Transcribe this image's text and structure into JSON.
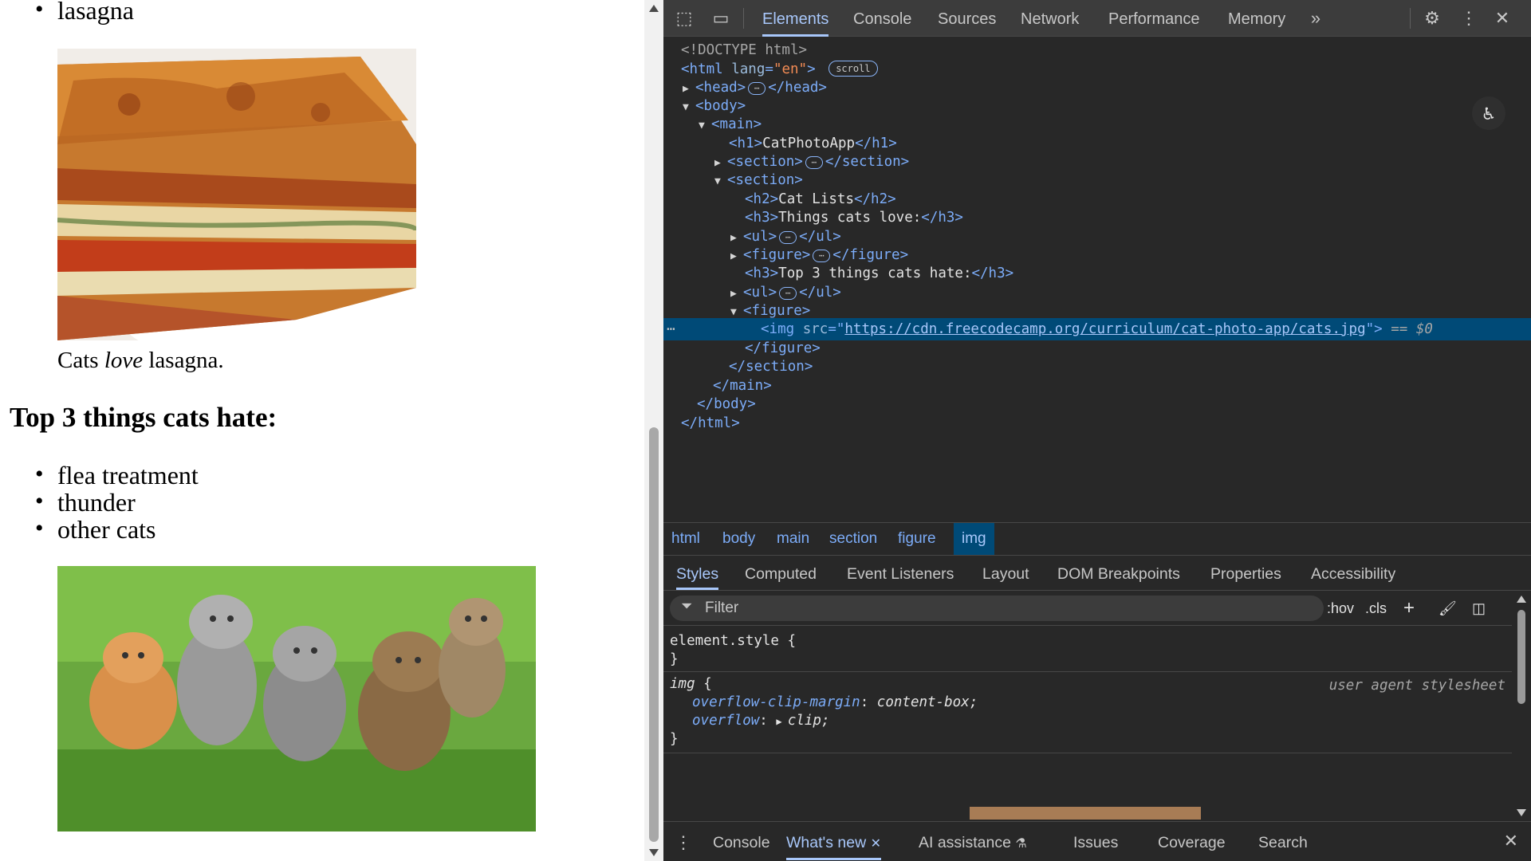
{
  "page": {
    "list_top": [
      "lasagna"
    ],
    "caption_pre": "Cats ",
    "caption_em": "love",
    "caption_post": " lasagna.",
    "hate_heading": "Top 3 things cats hate:",
    "hate_items": [
      "flea treatment",
      "thunder",
      "other cats"
    ]
  },
  "devtools": {
    "tabs": [
      "Elements",
      "Console",
      "Sources",
      "Network",
      "Performance",
      "Memory"
    ],
    "active_tab": "Elements",
    "more_tabs_icon": "chevron-double-right-icon",
    "dom": {
      "doctype": "<!DOCTYPE html>",
      "html_open": "<html",
      "lang_attr": "lang",
      "lang_val": "\"en\"",
      "scroll_pill": "scroll",
      "head_open": "<head>",
      "head_close": "</head>",
      "body_open": "<body>",
      "main_open": "<main>",
      "h1_open": "<h1>",
      "h1_text": "CatPhotoApp",
      "h1_close": "</h1>",
      "section_open": "<section>",
      "section_close": "</section>",
      "h2_open": "<h2>",
      "h2_text": "Cat Lists",
      "h2_close": "</h2>",
      "h3_open": "<h3>",
      "h3_text_love": "Things cats love:",
      "h3_close": "</h3>",
      "ul_open": "<ul>",
      "ul_close": "</ul>",
      "figure_open": "<figure>",
      "figure_close": "</figure>",
      "h3_text_hate": "Top 3 things cats hate:",
      "img_open": "<img",
      "src_attr": "src",
      "src_eq": "=\"",
      "src_url": "https://cdn.freecodecamp.org/curriculum/cat-photo-app/cats.jpg",
      "src_end": "\">",
      "selected_marker": "== $0",
      "main_close": "</main>",
      "body_close": "</body>",
      "html_close": "</html>",
      "ellipsis": "⋯"
    },
    "breadcrumbs": [
      "html",
      "body",
      "main",
      "section",
      "figure",
      "img"
    ],
    "active_crumb": "img",
    "subtabs": [
      "Styles",
      "Computed",
      "Event Listeners",
      "Layout",
      "DOM Breakpoints",
      "Properties",
      "Accessibility"
    ],
    "active_subtab": "Styles",
    "filter_placeholder": "Filter",
    "hov_label": ":hov",
    "cls_label": ".cls",
    "styles": {
      "element_style": "element.style {",
      "close_brace": "}",
      "img_selector": "img",
      "open_brace": " {",
      "ua_label": "user agent stylesheet",
      "prop1_name": "overflow-clip-margin",
      "prop1_value": "content-box;",
      "prop2_name": "overflow",
      "prop2_value": "clip;",
      "colon": ": "
    },
    "drawer_tabs": [
      "Console",
      "What's new",
      "AI assistance",
      "Issues",
      "Coverage",
      "Search"
    ],
    "active_drawer_tab": "What's new"
  }
}
